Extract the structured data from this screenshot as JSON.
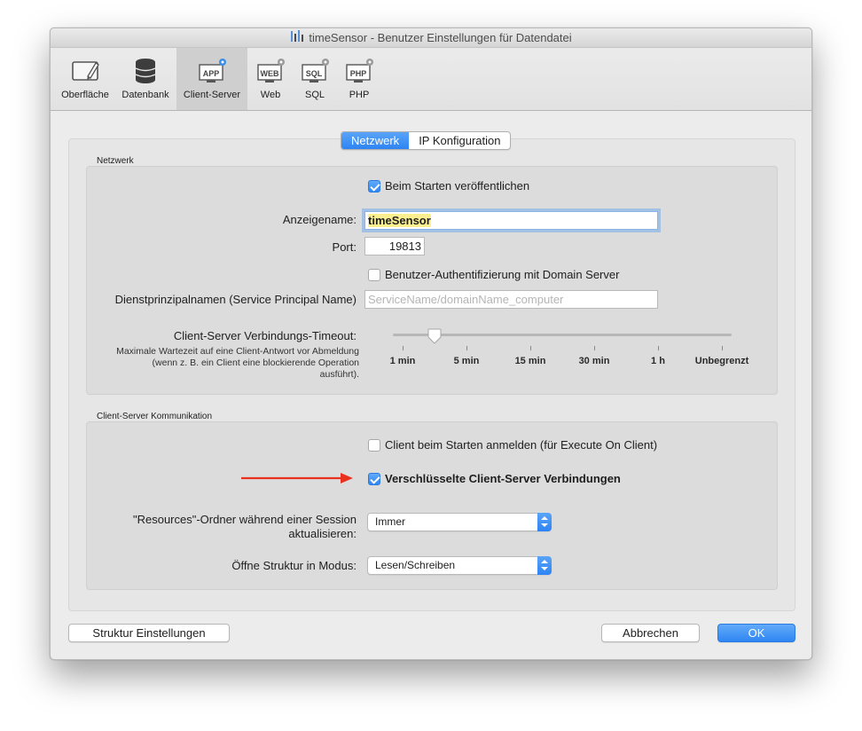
{
  "window": {
    "title": "timeSensor - Benutzer Einstellungen für Datendatei"
  },
  "toolbar": {
    "items": [
      {
        "label": "Oberfläche",
        "icon": "surface-icon",
        "active": false
      },
      {
        "label": "Datenbank",
        "icon": "database-icon",
        "active": false
      },
      {
        "label": "Client-Server",
        "icon": "app-server-icon",
        "active": true
      },
      {
        "label": "Web",
        "icon": "web-icon",
        "active": false
      },
      {
        "label": "SQL",
        "icon": "sql-icon",
        "active": false
      },
      {
        "label": "PHP",
        "icon": "php-icon",
        "active": false
      }
    ],
    "icon_texts": {
      "app": "APP",
      "web": "WEB",
      "sql": "SQL",
      "php": "PHP"
    }
  },
  "tabs": {
    "network": "Netzwerk",
    "ip": "IP Konfiguration",
    "selected": "Netzwerk"
  },
  "network": {
    "section_title": "Netzwerk",
    "publish_on_start": {
      "label": "Beim Starten veröffentlichen",
      "checked": true
    },
    "display_name": {
      "label": "Anzeigename:",
      "value": "timeSensor"
    },
    "port": {
      "label": "Port:",
      "value": "19813"
    },
    "domain_auth": {
      "label": "Benutzer-Authentifizierung mit Domain Server",
      "checked": false
    },
    "spn": {
      "label": "Dienstprinzipalnamen (Service Principal Name)",
      "placeholder": "ServiceName/domainName_computer"
    },
    "timeout": {
      "label": "Client-Server Verbindungs-Timeout:",
      "description": "Maximale Wartezeit auf eine Client-Antwort vor Abmeldung (wenn z. B. ein Client eine blockierende Operation ausführt).",
      "ticks": [
        "1 min",
        "5 min",
        "15 min",
        "30 min",
        "1 h",
        "Unbegrenzt"
      ],
      "value_index": 0.5
    }
  },
  "communication": {
    "section_title": "Client-Server Kommunikation",
    "register_on_start": {
      "label": "Client beim Starten anmelden (für Execute On Client)",
      "checked": false
    },
    "encrypted": {
      "label": "Verschlüsselte Client-Server Verbindungen",
      "checked": true
    },
    "resources": {
      "label": "\"Resources\"-Ordner während einer Session aktualisieren:",
      "value": "Immer"
    },
    "structure_mode": {
      "label": "Öffne Struktur in Modus:",
      "value": "Lesen/Schreiben"
    }
  },
  "buttons": {
    "structure": "Struktur Einstellungen",
    "cancel": "Abbrechen",
    "ok": "OK"
  },
  "colors": {
    "accent": "#2e84f3",
    "arrow": "#e8321f",
    "highlight": "#fbef8f"
  }
}
